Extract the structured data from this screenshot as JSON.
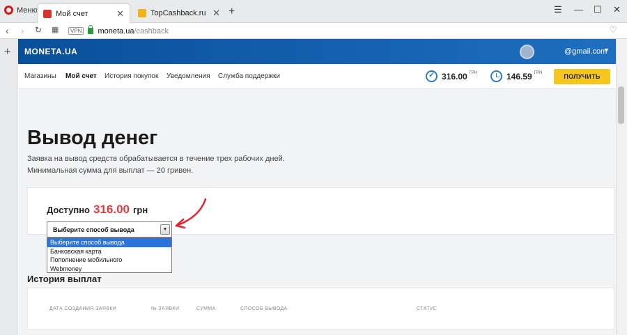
{
  "browser": {
    "menu_label": "Меню",
    "tabs": [
      {
        "title": "Мой счет",
        "active": true
      },
      {
        "title": "TopCashback.ru - Топ лучши"
      }
    ],
    "address": {
      "vpn_label": "VPN",
      "host": "moneta.ua",
      "path": "/cashback"
    }
  },
  "site": {
    "logo": "MONETA.UA",
    "user_email": "@gmail.com",
    "nav": [
      "Магазины",
      "Мой счет",
      "История покупок",
      "Уведомления",
      "Служба поддержки"
    ],
    "balances": [
      {
        "amount": "316.00",
        "unit": "ГРН"
      },
      {
        "amount": "146.59",
        "unit": "ГРН"
      }
    ],
    "get_button": "ПОЛУЧИТЬ"
  },
  "page": {
    "title": "Вывод денег",
    "description": [
      "Заявка на вывод средств обрабатывается в течение трех рабочих дней.",
      "Минимальная сумма для выплат — 20 гривен."
    ],
    "available_label": "Доступно",
    "available_amount": "316.00",
    "available_unit": "грн",
    "withdraw_select": {
      "value": "Выберите способ вывода",
      "options": [
        "Выберите способ вывода",
        "Банковская карта",
        "Пополнение мобильного",
        "Webmoney"
      ]
    },
    "history_title": "История выплат",
    "history_columns": [
      "ДАТА СОЗДАНИЯ ЗАЯВКИ",
      "№ ЗАЯВКИ",
      "СУММА",
      "СПОСОБ ВЫВОДА",
      "СТАТУС"
    ]
  },
  "colors": {
    "brand_blue": "#0a4f9a",
    "accent_yellow": "#f5c61e",
    "amount_red": "#e0393e",
    "annotation_red": "#e8202a"
  }
}
